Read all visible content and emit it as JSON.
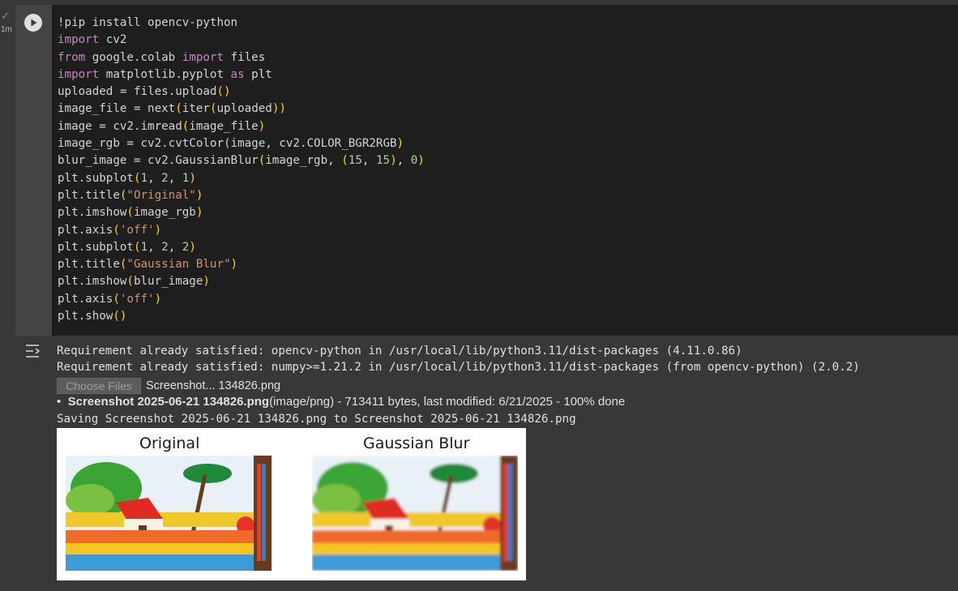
{
  "cell": {
    "status_icon": "check-icon",
    "exec_time": "1m",
    "run_icon": "play-icon",
    "code_lines": [
      "!pip install opencv-python",
      "import cv2",
      "from google.colab import files",
      "import matplotlib.pyplot as plt",
      "uploaded = files.upload()",
      "image_file = next(iter(uploaded))",
      "image = cv2.imread(image_file)",
      "image_rgb = cv2.cvtColor(image, cv2.COLOR_BGR2RGB)",
      "blur_image = cv2.GaussianBlur(image_rgb, (15, 15), 0)",
      "plt.subplot(1, 2, 1)",
      "plt.title(\"Original\")",
      "plt.imshow(image_rgb)",
      "plt.axis('off')",
      "plt.subplot(1, 2, 2)",
      "plt.title(\"Gaussian Blur\")",
      "plt.imshow(blur_image)",
      "plt.axis('off')",
      "plt.show()"
    ]
  },
  "output": {
    "icon": "output-toggle-icon",
    "lines": [
      "Requirement already satisfied: opencv-python in /usr/local/lib/python3.11/dist-packages (4.11.0.86)",
      "Requirement already satisfied: numpy>=1.21.2 in /usr/local/lib/python3.11/dist-packages (from opencv-python) (2.0.2)"
    ],
    "upload": {
      "button_label": "Choose Files",
      "file_name": "Screenshot... 134826.png"
    },
    "file_item": {
      "name": "Screenshot 2025-06-21 134826.png",
      "details": "(image/png) - 713411 bytes, last modified: 6/21/2025 - 100% done"
    },
    "saving_line": "Saving Screenshot 2025-06-21 134826.png to Screenshot 2025-06-21 134826.png",
    "figure": {
      "left_title": "Original",
      "right_title": "Gaussian Blur"
    }
  },
  "colors": {
    "editor_bg": "#1e1e1e",
    "output_bg": "#383838",
    "keyword": "#c586c0",
    "string": "#ce9178",
    "number": "#b5cea8",
    "bracket": "#ffd700"
  }
}
